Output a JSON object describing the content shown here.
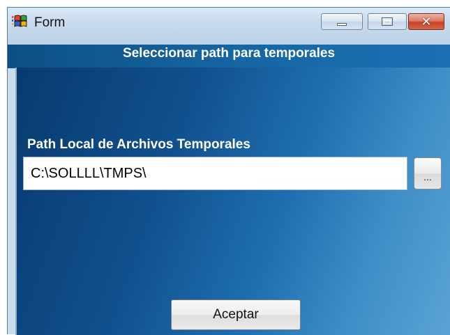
{
  "window": {
    "title": "Form",
    "icon": "windows-flag-icon",
    "controls": {
      "minimize": "minimize-icon",
      "maximize": "maximize-icon",
      "close": "close-icon"
    }
  },
  "header": {
    "text": "Seleccionar path para temporales"
  },
  "form": {
    "path_label": "Path Local de Archivos Temporales",
    "path_value": "C:\\SOLLLL\\TMPS\\",
    "browse_label": "...",
    "accept_label": "Aceptar"
  },
  "colors": {
    "title_bar": "#c7d9ec",
    "header_band": "#1565a2",
    "client_dark": "#083a6f",
    "client_light": "#5aa3d6",
    "close_button": "#c7432a"
  }
}
